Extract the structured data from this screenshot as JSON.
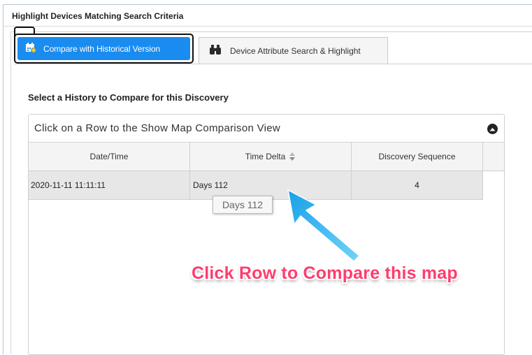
{
  "window": {
    "title": "Highlight Devices Matching Search Criteria"
  },
  "tabs": [
    {
      "label": "Compare with Historical Version",
      "icon": "calendar-clock-icon",
      "active": true
    },
    {
      "label": "Device Attribute Search & Highlight",
      "icon": "binoculars-icon",
      "active": false
    }
  ],
  "section": {
    "label": "Select a History to Compare for this Discovery"
  },
  "panel": {
    "title": "Click on a Row to the Show Map Comparison View"
  },
  "table": {
    "columns": [
      "Date/Time",
      "Time Delta",
      "Discovery Sequence"
    ],
    "rows": [
      {
        "datetime": "2020-11-11 11:11:11",
        "time_delta": "Days 112",
        "sequence": "4"
      }
    ]
  },
  "tooltip": {
    "text": "Days 112"
  },
  "annotation": {
    "text": "Click Row to Compare this map"
  },
  "colors": {
    "tab_active": "#1a8cf0",
    "annotation_text": "#ff3d6e",
    "annotation_arrow": "#2bb3ee"
  }
}
